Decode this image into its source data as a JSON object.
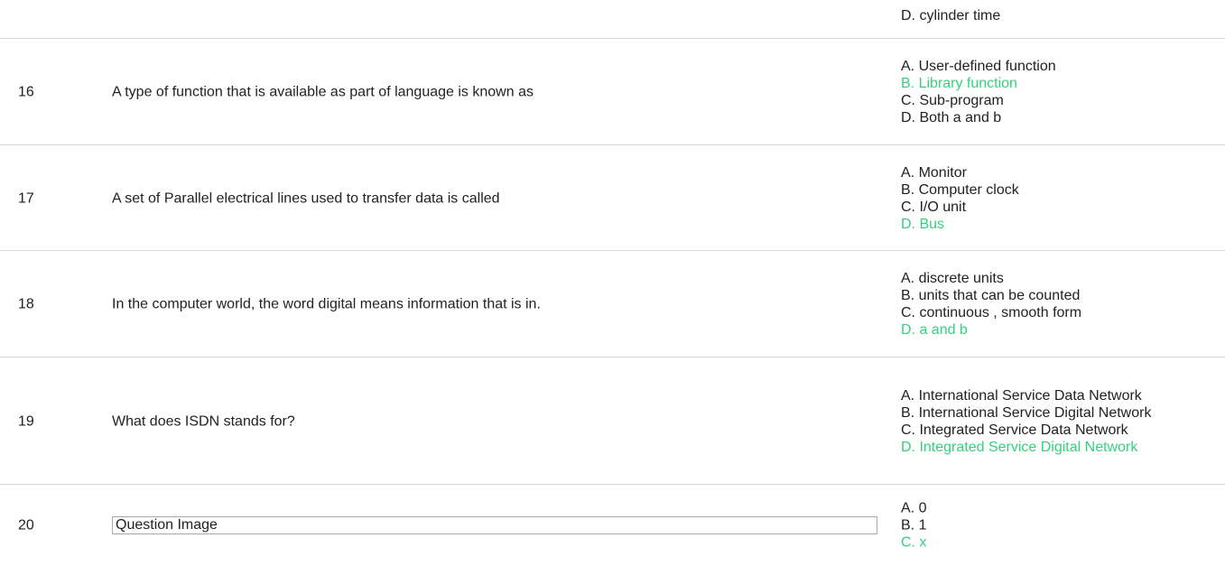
{
  "partial_row": {
    "option": "D. cylinder time"
  },
  "colors": {
    "correct": "#35d07f",
    "text": "#222222",
    "separator": "#d9d9d9"
  },
  "questions": [
    {
      "number": "16",
      "text": "A type of function that is available as part of language is known as",
      "options": [
        {
          "text": "A. User-defined function",
          "correct": false
        },
        {
          "text": "B. Library function",
          "correct": true
        },
        {
          "text": "C. Sub-program",
          "correct": false
        },
        {
          "text": "D. Both a and b",
          "correct": false
        }
      ]
    },
    {
      "number": "17",
      "text": "A set of Parallel electrical lines used to transfer data is called",
      "options": [
        {
          "text": "A. Monitor",
          "correct": false
        },
        {
          "text": "B. Computer clock",
          "correct": false
        },
        {
          "text": "C. I/O unit",
          "correct": false
        },
        {
          "text": "D. Bus",
          "correct": true
        }
      ]
    },
    {
      "number": "18",
      "text": "In the computer world, the word digital means information that is in.",
      "options": [
        {
          "text": "A. discrete units",
          "correct": false
        },
        {
          "text": "B. units that can be counted",
          "correct": false
        },
        {
          "text": "C. continuous , smooth form",
          "correct": false
        },
        {
          "text": "D. a and b",
          "correct": true
        }
      ]
    },
    {
      "number": "19",
      "text": "What does ISDN stands for?",
      "options": [
        {
          "text": "A. International Service Data Network",
          "correct": false
        },
        {
          "text": "B. International Service Digital Network",
          "correct": false
        },
        {
          "text": "C. Integrated Service Data Network",
          "correct": false
        },
        {
          "text": "D. Integrated Service Digital Network",
          "correct": true
        }
      ]
    },
    {
      "number": "20",
      "image_alt": "Question Image",
      "options": [
        {
          "text": "A. 0",
          "correct": false
        },
        {
          "text": "B. 1",
          "correct": false
        },
        {
          "text": "C. x",
          "correct": true
        }
      ]
    }
  ]
}
